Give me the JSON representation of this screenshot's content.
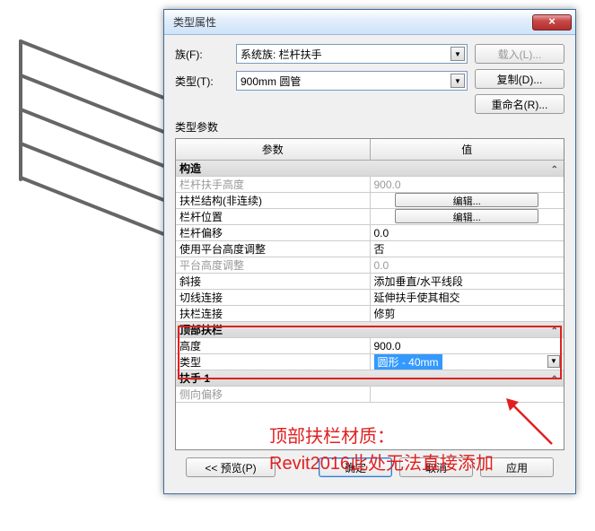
{
  "dialog": {
    "title": "类型属性",
    "close_glyph": "×",
    "family_label": "族(F):",
    "family_value": "系统族: 栏杆扶手",
    "type_label": "类型(T):",
    "type_value": "900mm 圆管",
    "load_btn": "载入(L)...",
    "dup_btn": "复制(D)...",
    "rename_btn": "重命名(R)...",
    "params_label": "类型参数",
    "col_param": "参数",
    "col_value": "值"
  },
  "rows": {
    "cat_construct": "构造",
    "rail_height_l": "栏杆扶手高度",
    "rail_height_v": "900.0",
    "handrail_struct_l": "扶栏结构(非连续)",
    "edit1": "编辑...",
    "baluster_pos_l": "栏杆位置",
    "edit2": "编辑...",
    "baluster_off_l": "栏杆偏移",
    "baluster_off_v": "0.0",
    "use_landing_l": "使用平台高度调整",
    "use_landing_v": "否",
    "landing_adj_l": "平台高度调整",
    "landing_adj_v": "0.0",
    "angled_l": "斜接",
    "angled_v": "添加垂直/水平线段",
    "tangent_l": "切线连接",
    "tangent_v": "延伸扶手使其相交",
    "rail_conn_l": "扶栏连接",
    "rail_conn_v": "修剪",
    "cat_top": "顶部扶栏",
    "height_l": "高度",
    "height_v": "900.0",
    "type_l": "类型",
    "type_v": "圆形 - 40mm",
    "cat_hand1": "扶手 1",
    "side_off_l": "侧向偏移",
    "side_off_v": ""
  },
  "footer": {
    "preview": "<< 预览(P)",
    "ok": "确定",
    "cancel": "取消",
    "apply": "应用"
  },
  "annot": {
    "line1": "顶部扶栏材质：",
    "line2": "Revit2016此处无法直接添加"
  }
}
